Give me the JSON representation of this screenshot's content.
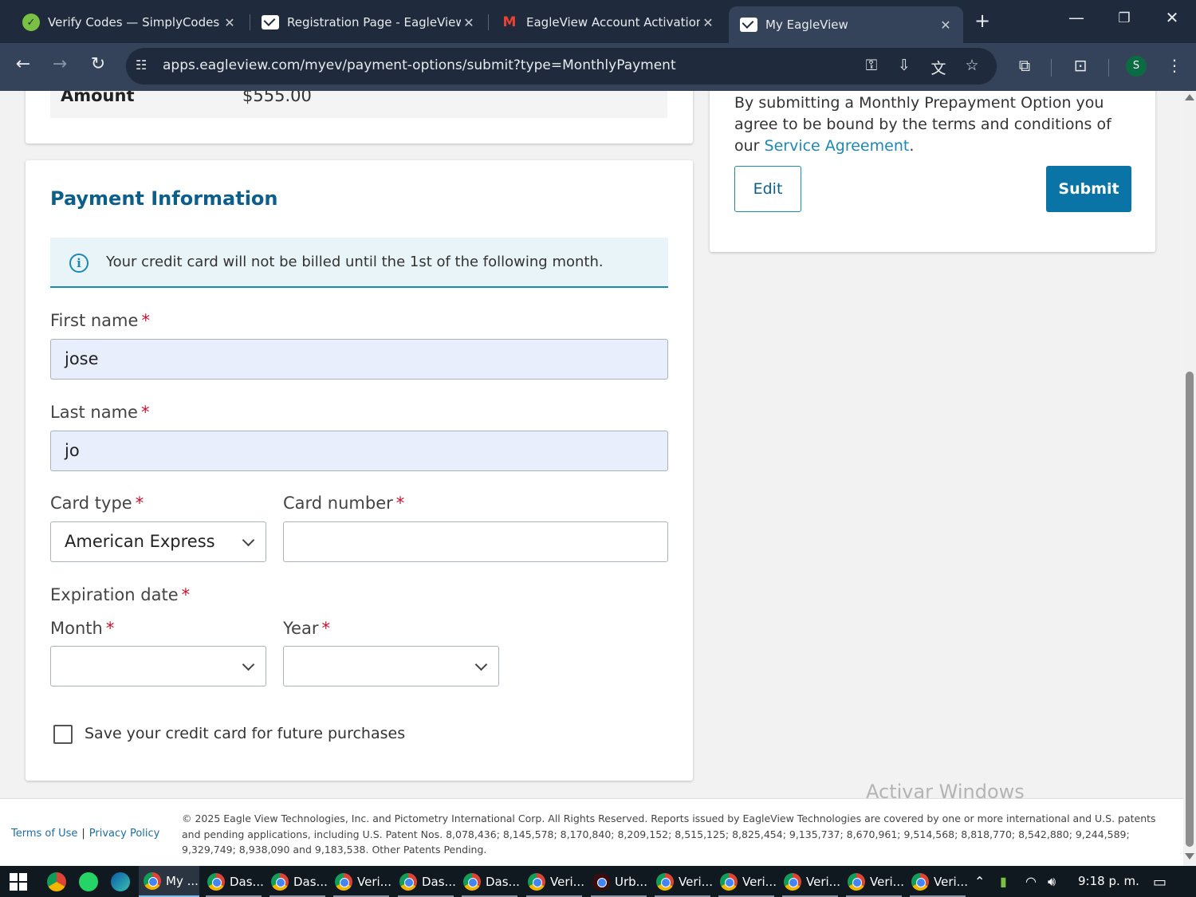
{
  "browser": {
    "tabs": [
      {
        "title": "Verify Codes — SimplyCodes",
        "icon": "simplycodes-favicon"
      },
      {
        "title": "Registration Page - EagleView",
        "icon": "eagleview-favicon"
      },
      {
        "title": "EagleView Account Activation",
        "icon": "gmail-favicon"
      },
      {
        "title": "My EagleView",
        "icon": "eagleview-favicon"
      }
    ],
    "url": "apps.eagleview.com/myev/payment-options/submit?type=MonthlyPayment",
    "profile_initial": "S"
  },
  "summary": {
    "amount_label": "Amount",
    "amount_value": "$555.00"
  },
  "payment": {
    "title": "Payment Information",
    "info_message": "Your credit card will not be billed until the 1st of the following month.",
    "first_name_label": "First name",
    "first_name_value": "jose",
    "last_name_label": "Last name",
    "last_name_value": "jo",
    "card_type_label": "Card type",
    "card_type_value": "American Express",
    "card_number_label": "Card number",
    "card_number_value": "",
    "expiration_label": "Expiration date",
    "month_label": "Month",
    "month_value": "",
    "year_label": "Year",
    "year_value": "",
    "required_mark": "*",
    "save_card_label": "Save your credit card for future purchases",
    "save_card_checked": false
  },
  "submit_panel": {
    "agree_text": "By submitting a Monthly Prepayment Option you agree to be bound by the terms and conditions of our ",
    "agree_link": "Service Agreement",
    "agree_end": ".",
    "edit_label": "Edit",
    "submit_label": "Submit"
  },
  "footer": {
    "terms": "Terms of Use",
    "separator": "|",
    "privacy": "Privacy Policy",
    "copyright": "© 2025 Eagle View Technologies, Inc. and Pictometry International Corp. All Rights Reserved. Reports issued by EagleView Technologies are covered by one or more international and U.S. patents and pending applications, including U.S. Patent Nos. 8,078,436; 8,145,578; 8,170,840; 8,209,152; 8,515,125; 8,825,454; 9,135,737; 8,670,961; 9,514,568; 8,818,770; 8,542,880; 9,244,589; 9,329,749; 8,938,090 and 9,183,538. Other Patents Pending."
  },
  "watermark": "Activar Windows",
  "taskbar": {
    "items": [
      "My ...",
      "Das...",
      "Das...",
      "Veri...",
      "Das...",
      "Das...",
      "Veri...",
      "Urb...",
      "Veri...",
      "Veri...",
      "Veri...",
      "Veri...",
      "Veri..."
    ],
    "clock": "9:18 p. m."
  },
  "colors": {
    "brand_blue": "#0b74a6",
    "link_blue": "#1b88b5",
    "required_red": "#c8102e",
    "autofill_bg": "#e8eefc"
  }
}
